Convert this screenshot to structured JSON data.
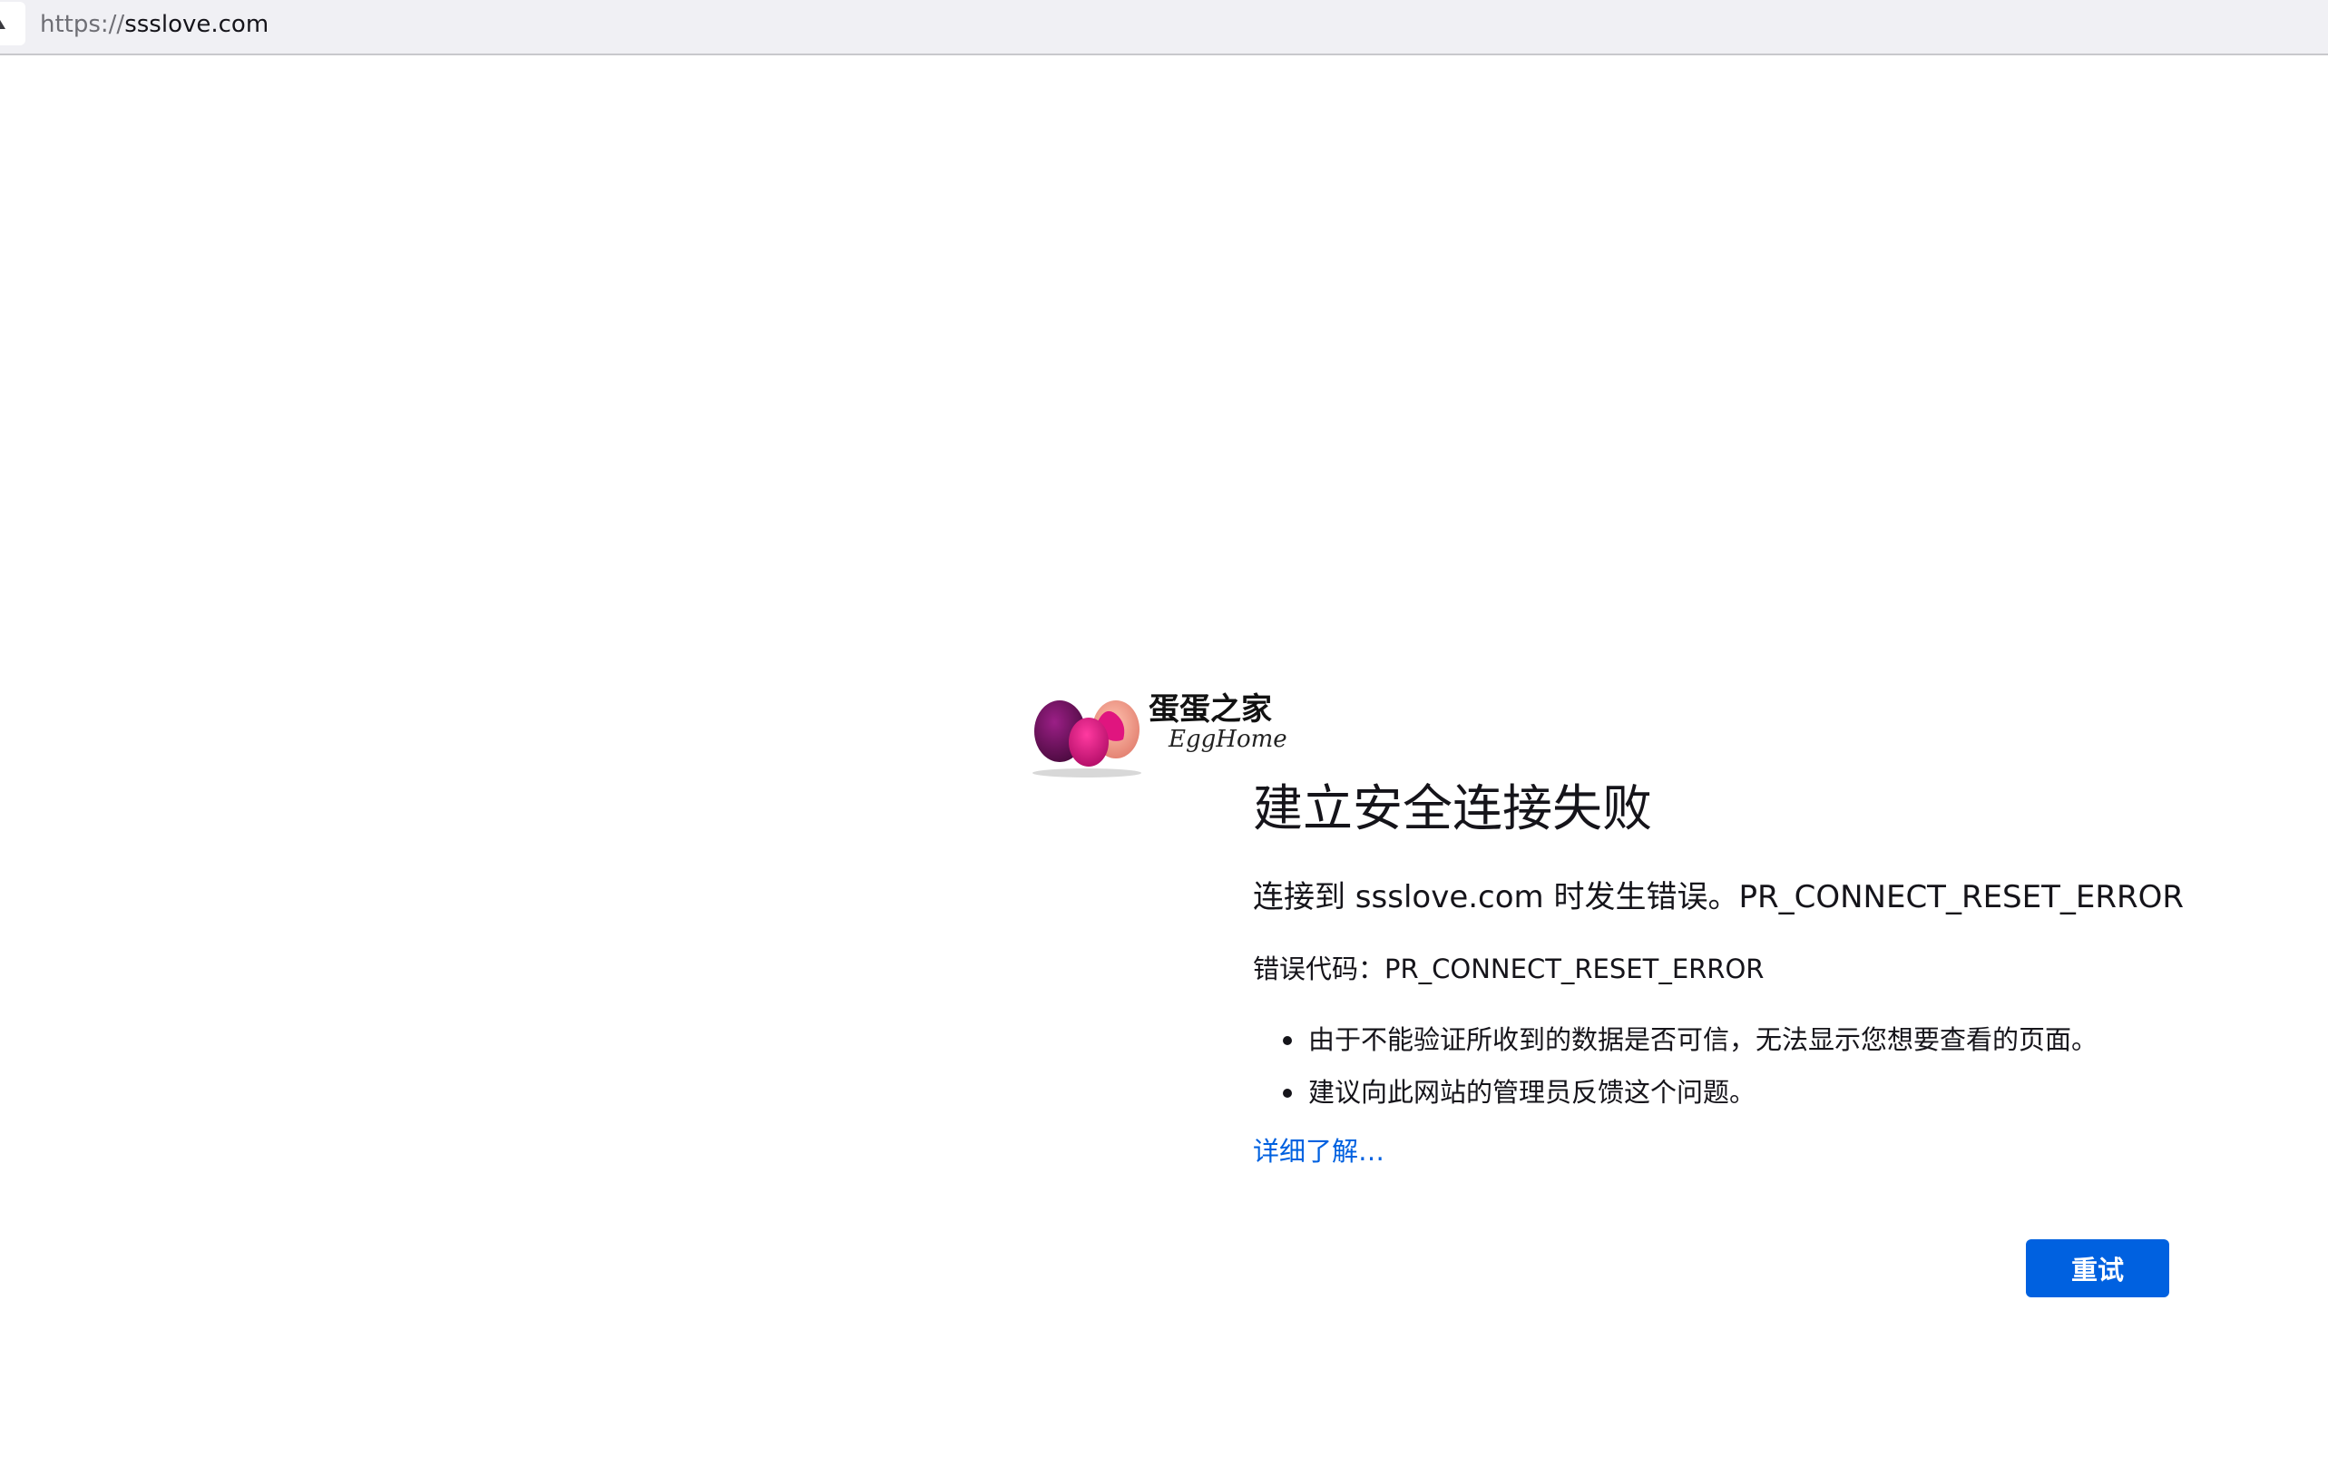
{
  "browser": {
    "url_scheme": "https://",
    "url_host": "ssslove.com",
    "lock_icon": "warning-lock-icon"
  },
  "logo": {
    "chinese_text": "蛋蛋之家",
    "english_text": "EggHome",
    "colors": [
      "#6b0f5a",
      "#e0157f",
      "#f29a8a"
    ]
  },
  "error": {
    "title": "建立安全连接失败",
    "description": "连接到 ssslove.com 时发生错误。PR_CONNECT_RESET_ERROR",
    "code_label": "错误代码：",
    "code_value": "PR_CONNECT_RESET_ERROR",
    "bullets": [
      "由于不能验证所收到的数据是否可信，无法显示您想要查看的页面。",
      "建议向此网站的管理员反馈这个问题。"
    ],
    "learn_more": "详细了解…",
    "retry_label": "重试"
  },
  "colors": {
    "accent": "#0061e0",
    "text": "#15141a"
  }
}
